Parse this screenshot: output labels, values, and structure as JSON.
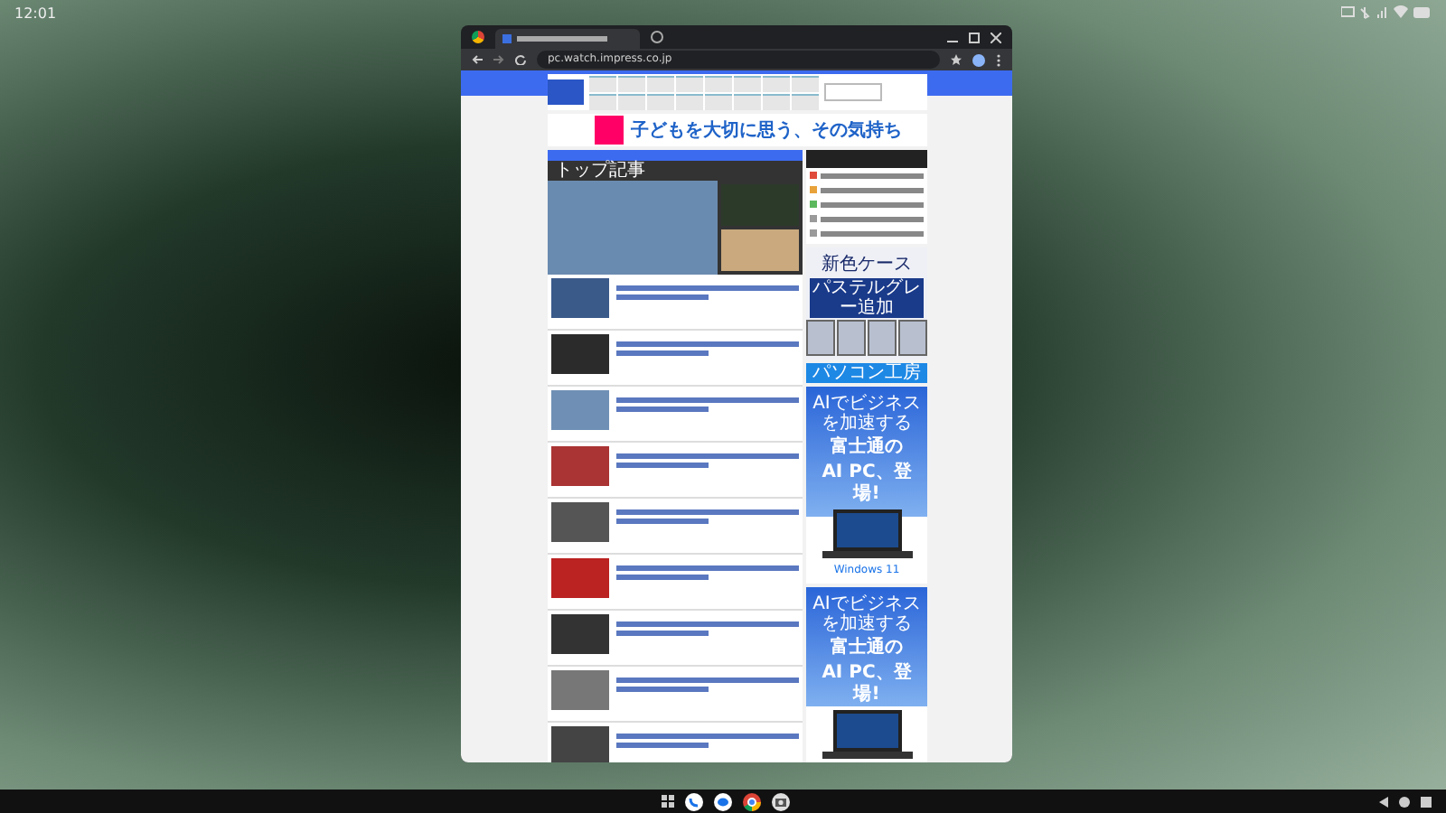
{
  "status_bar": {
    "time": "12:01"
  },
  "browser": {
    "url": "pc.watch.impress.co.jp"
  },
  "page": {
    "banner": {
      "headline": "子どもを大切に思う、その気持ち"
    },
    "top_section": {
      "title": "トップ記事"
    },
    "ranking": [
      {
        "color": "#e04a3a"
      },
      {
        "color": "#e8a23a"
      },
      {
        "color": "#5cb85c"
      },
      {
        "color": "#9a9a9a"
      },
      {
        "color": "#9a9a9a"
      }
    ],
    "ads": [
      {
        "kind": "case",
        "subtitle": "新色ケース",
        "title": "パステルグレー追加"
      },
      {
        "kind": "shopbar",
        "title": "パソコン工房"
      },
      {
        "kind": "laptop",
        "tagline": "AIでビジネスを加速する",
        "title": "富士通の",
        "title2": "AI PC、登場!",
        "badge": "Windows 11"
      },
      {
        "kind": "laptop",
        "tagline": "AIでビジネスを加速する",
        "title": "富士通の",
        "title2": "AI PC、登場!"
      }
    ]
  }
}
